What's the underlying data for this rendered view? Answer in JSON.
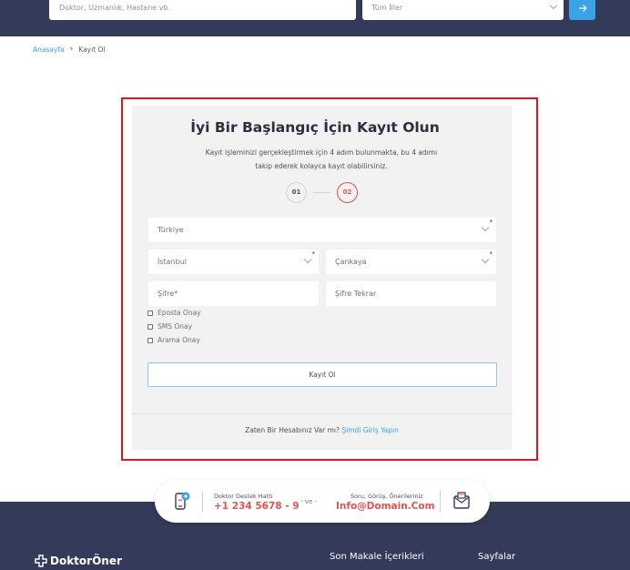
{
  "header": {
    "search_placeholder": "Doktor, Uzmanlık, Hastane vb.",
    "city_select": "Tüm İller",
    "search_button_icon": "arrow-right-icon"
  },
  "breadcrumb": {
    "home": "Anasayfa",
    "separator": "›",
    "current": "Kayıt Ol"
  },
  "register": {
    "title": "İyi Bir Başlangıç İçin Kayıt Olun",
    "description": "Kayıt işleminizi gerçekleştirmek için 4 adım bulunmakta, bu 4 adımı takip ederek kolayca kayıt olabilirsiniz.",
    "steps": [
      "01",
      "02"
    ],
    "active_step": "02",
    "country": "Türkiye",
    "city": "İstanbul",
    "district": "Çankaya",
    "password_placeholder": "Şifre*",
    "password_repeat_placeholder": "Şifre Tekrar",
    "checkboxes": [
      "Eposta Onay",
      "SMS Onay",
      "Arama Onay"
    ],
    "submit_label": "Kayıt Ol",
    "login_prompt": "Zaten Bir Hesabınız Var mı?",
    "login_link": "Şimdi Giriş Yapın"
  },
  "support": {
    "phone_label": "Doktor Destek Hattı",
    "phone_value": "+1 234 5678 - 9",
    "and": "- ve -",
    "mail_label": "Soru, Görüş, Önerileriniz",
    "mail_value": "Info@Domain.Com"
  },
  "footer": {
    "logo_text": "DoktorÖner",
    "col1_title": "Son Makale İçerikleri",
    "col2_title": "Sayfalar"
  },
  "colors": {
    "navy": "#343a59",
    "accent_blue": "#3aa3e8",
    "accent_red": "#e8504d",
    "highlight_border": "#e1151b"
  }
}
